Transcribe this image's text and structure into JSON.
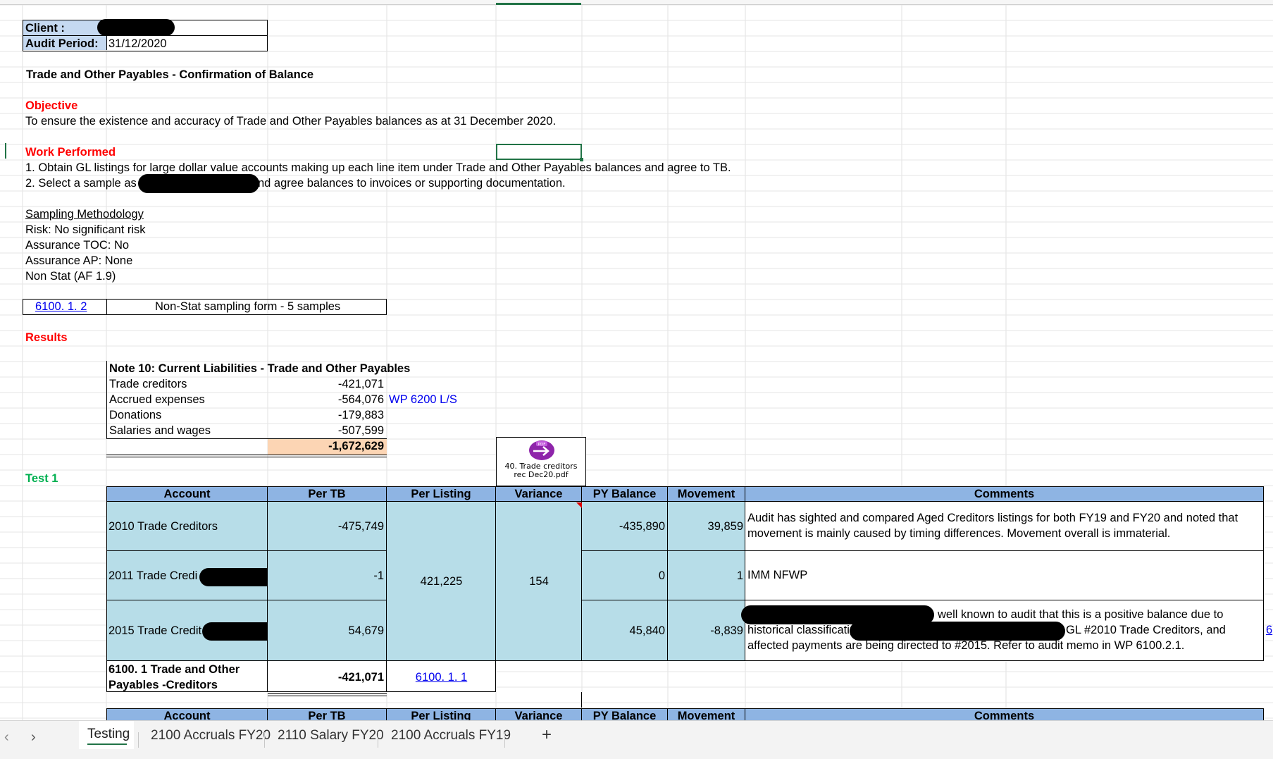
{
  "header": {
    "client_label": "Client :",
    "period_label": "Audit Period:",
    "period_value": "31/12/2020"
  },
  "title": "Trade and Other Payables - Confirmation of Balance",
  "objective": {
    "heading": "Objective",
    "text": "To ensure the existence and accuracy of Trade and Other Payables balances as at 31 December 2020."
  },
  "work": {
    "heading": "Work Performed",
    "step1": "1. Obtain GL listings for large dollar value accounts making up each line item under Trade and Other Payables balances and agree to TB.",
    "step2a": "2. Select a sample as",
    "step2b": "nd agree balances to invoices or supporting documentation."
  },
  "sampling": {
    "heading": "Sampling Methodology",
    "risk": "Risk: No significant risk",
    "toc": "Assurance TOC: No",
    "ap": "Assurance AP: None",
    "nonstat": "Non Stat (AF 1.9)"
  },
  "ref_box": {
    "link": "6100. 1. 2",
    "label": "Non-Stat sampling form - 5 samples"
  },
  "results_heading": "Results",
  "note10": {
    "title": "Note 10: Current Liabilities - Trade and Other Payables",
    "rows": [
      {
        "label": "Trade creditors",
        "value": "-421,071",
        "ref": ""
      },
      {
        "label": "Accrued expenses",
        "value": "-564,076",
        "ref": "WP 6200 L/S"
      },
      {
        "label": "Donations",
        "value": "-179,883",
        "ref": ""
      },
      {
        "label": "Salaries and wages",
        "value": "-507,599",
        "ref": ""
      }
    ],
    "total": "-1,672,629"
  },
  "test1_heading": "Test 1",
  "pdf": {
    "line1": "40. Trade creditors",
    "line2": "rec Dec20.pdf",
    "badge": "PDF"
  },
  "table": {
    "headers": [
      "Account",
      "Per TB",
      "Per Listing",
      "Variance",
      "PY Balance",
      "Movement",
      "Comments"
    ],
    "rows": [
      {
        "account": "2010 Trade Creditors",
        "per_tb": "-475,749",
        "py": "-435,890",
        "movement": "39,859",
        "comment1": "Audit has sighted and compared Aged Creditors listings for both FY19 and FY20 and noted that",
        "comment2": "movement is mainly caused by timing differences. Movement overall is immaterial."
      },
      {
        "account": "2011 Trade Credi",
        "per_tb": "-1",
        "py": "0",
        "movement": "1",
        "comment1": "IMM NFWP"
      },
      {
        "account": "2015 Trade Credit",
        "per_tb": "54,679",
        "py": "45,840",
        "movement": "-8,839",
        "comment1": "well known to audit that this is a positive balance due to",
        "comment2a": "historical classificati",
        "comment2b": "GL #2010 Trade Creditors, and",
        "comment3": "affected payments are being directed to #2015. Refer to audit memo in WP 6100.2.1.",
        "overflow": "6"
      }
    ],
    "per_listing_merged": "421,225",
    "variance_merged": "154",
    "total_label1": "6100. 1 Trade and Other",
    "total_label2": "Payables -Creditors",
    "total_per_tb": "-421,071",
    "total_link": "6100. 1. 1"
  },
  "tabs": [
    "Testing",
    "2100 Accruals FY20",
    "2110 Salary FY20",
    "2100 Accruals FY19"
  ],
  "add_tab": "+"
}
